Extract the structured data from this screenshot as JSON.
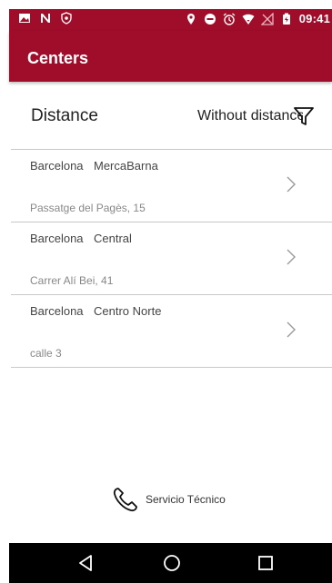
{
  "status_bar": {
    "time": "09:41",
    "icons_left": [
      "image-icon",
      "n-icon",
      "shield-icon"
    ],
    "icons_right": [
      "location-icon",
      "do-not-disturb-icon",
      "alarm-icon",
      "wifi-icon",
      "no-signal-icon",
      "battery-icon"
    ]
  },
  "app_bar": {
    "title": "Centers",
    "color": "#9f0d2a"
  },
  "filter": {
    "label": "Distance",
    "value": "Without distance"
  },
  "centers": [
    {
      "city": "Barcelona",
      "name": "MercaBarna",
      "address": "Passatge del Pagès, 15"
    },
    {
      "city": "Barcelona",
      "name": "Central",
      "address": "Carrer Alí Bei, 41"
    },
    {
      "city": "Barcelona",
      "name": "Centro Norte",
      "address": "calle 3"
    }
  ],
  "service": {
    "label": "Servicio Técnico"
  },
  "nav_bar": {
    "buttons": [
      "back-icon",
      "home-icon",
      "recents-icon"
    ]
  }
}
